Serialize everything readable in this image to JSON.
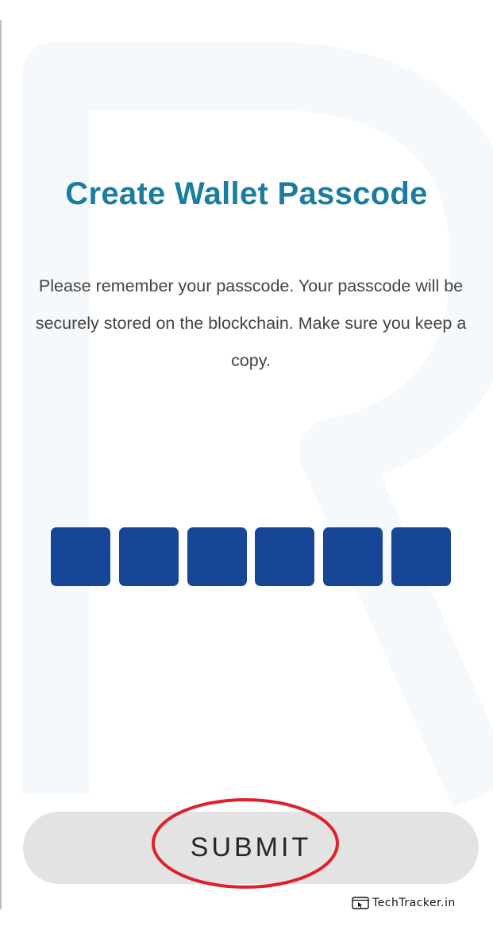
{
  "screen": {
    "title": "Create Wallet Passcode",
    "description": "Please remember your passcode. Your passcode will be securely stored on the blockchain. Make sure you keep a copy."
  },
  "passcode": {
    "digit_count": 6,
    "fill_color": "#174696"
  },
  "actions": {
    "submit_label": "SUBMIT"
  },
  "annotation": {
    "highlight_color": "#e0202a",
    "highlights": "submit-button"
  },
  "watermark": {
    "brand": "TechTracker.in",
    "icon": "browser-cursor-icon"
  },
  "colors": {
    "title": "#1b7ca3",
    "body_text": "#444444",
    "button_bg": "#e3e3e3"
  }
}
